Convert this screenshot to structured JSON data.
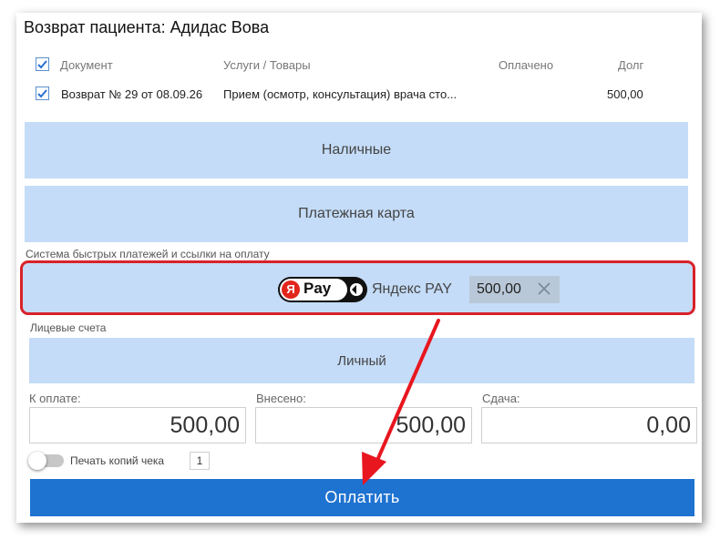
{
  "dialog": {
    "title": "Возврат пациента: Адидас Вова"
  },
  "table": {
    "headers": {
      "document": "Документ",
      "services": "Услуги / Товары",
      "paid": "Оплачено",
      "debt": "Долг"
    },
    "rows": [
      {
        "document": "Возврат № 29 от 08.09.26",
        "services": "Прием (осмотр, консультация) врача сто...",
        "paid": "",
        "debt": "500,00",
        "checked": true
      }
    ]
  },
  "payment_methods": {
    "cash": "Наличные",
    "card": "Платежная карта"
  },
  "fast_payments": {
    "section_label": "Система быстрых платежей и ссылки на оплату",
    "logo_letter": "Я",
    "logo_text": "Pay",
    "label": "Яндекс PAY",
    "amount": "500,00"
  },
  "accounts": {
    "section_label": "Лицевые счета",
    "personal": "Личный"
  },
  "totals": {
    "to_pay_label": "К оплате:",
    "to_pay": "500,00",
    "deposited_label": "Внесено:",
    "deposited": "500,00",
    "change_label": "Сдача:",
    "change": "0,00"
  },
  "print": {
    "label": "Печать копий чека",
    "copies": "1",
    "enabled": false
  },
  "submit_label": "Оплатить",
  "colors": {
    "accent": "#1e72d0",
    "method_bg": "#c4dcf7",
    "highlight": "#d9222a"
  }
}
